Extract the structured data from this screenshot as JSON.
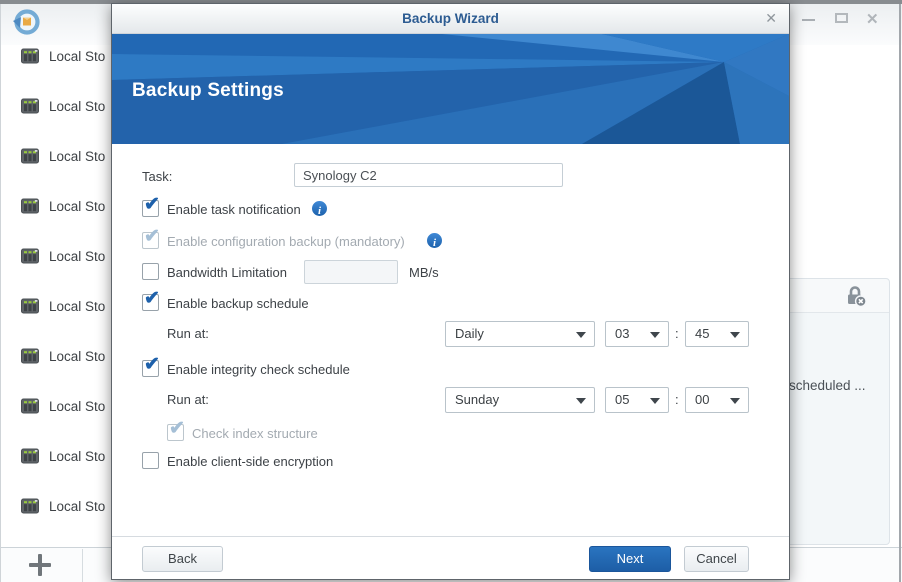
{
  "background": {
    "logo_icon": "hyper-backup-circular-arrow",
    "window_controls": {
      "minimize_icon": "minimize",
      "maximize_icon": "maximize",
      "close_icon": "close"
    },
    "sidebar": {
      "items": [
        "Local Sto",
        "Local Sto",
        "Local Sto",
        "Local Sto",
        "Local Sto",
        "Local Sto",
        "Local Sto",
        "Local Sto",
        "Local Sto",
        "Local Sto"
      ]
    },
    "toolbar": {
      "add_icon": "plus"
    },
    "right_panel": {
      "lock_icon": "lock-with-x-badge",
      "text": "scheduled ..."
    }
  },
  "dialog": {
    "title": "Backup Wizard",
    "close_icon": "✕",
    "header": {
      "title": "Backup Settings"
    },
    "form": {
      "task": {
        "label": "Task:",
        "value": "Synology C2"
      },
      "task_notification": {
        "label": "Enable task notification",
        "checked": true,
        "disabled": false,
        "info_icon": "info"
      },
      "config_backup": {
        "label": "Enable configuration backup (mandatory)",
        "checked": true,
        "disabled": true,
        "info_icon": "info"
      },
      "bandwidth": {
        "label": "Bandwidth Limitation",
        "checked": false,
        "value": "",
        "unit": "MB/s"
      },
      "backup_schedule": {
        "label": "Enable backup schedule",
        "checked": true,
        "run_at": {
          "label": "Run at:",
          "frequency": "Daily",
          "hour": "03",
          "colon": ":",
          "minute": "45"
        }
      },
      "integrity_schedule": {
        "label": "Enable integrity check schedule",
        "checked": true,
        "run_at": {
          "label": "Run at:",
          "frequency": "Sunday",
          "hour": "05",
          "colon": ":",
          "minute": "00"
        }
      },
      "check_index": {
        "label": "Check index structure",
        "checked": true,
        "disabled": true
      },
      "client_encryption": {
        "label": "Enable client-side encryption",
        "checked": false
      }
    },
    "footer": {
      "back_label": "Back",
      "next_label": "Next",
      "cancel_label": "Cancel"
    }
  },
  "colors": {
    "header_blue": "#2268b4",
    "primary_button_blue": "#2069b4",
    "check_blue": "#1e61ab",
    "title_text_blue": "#2d5c92",
    "info_icon_blue": "#2e7bd0"
  }
}
